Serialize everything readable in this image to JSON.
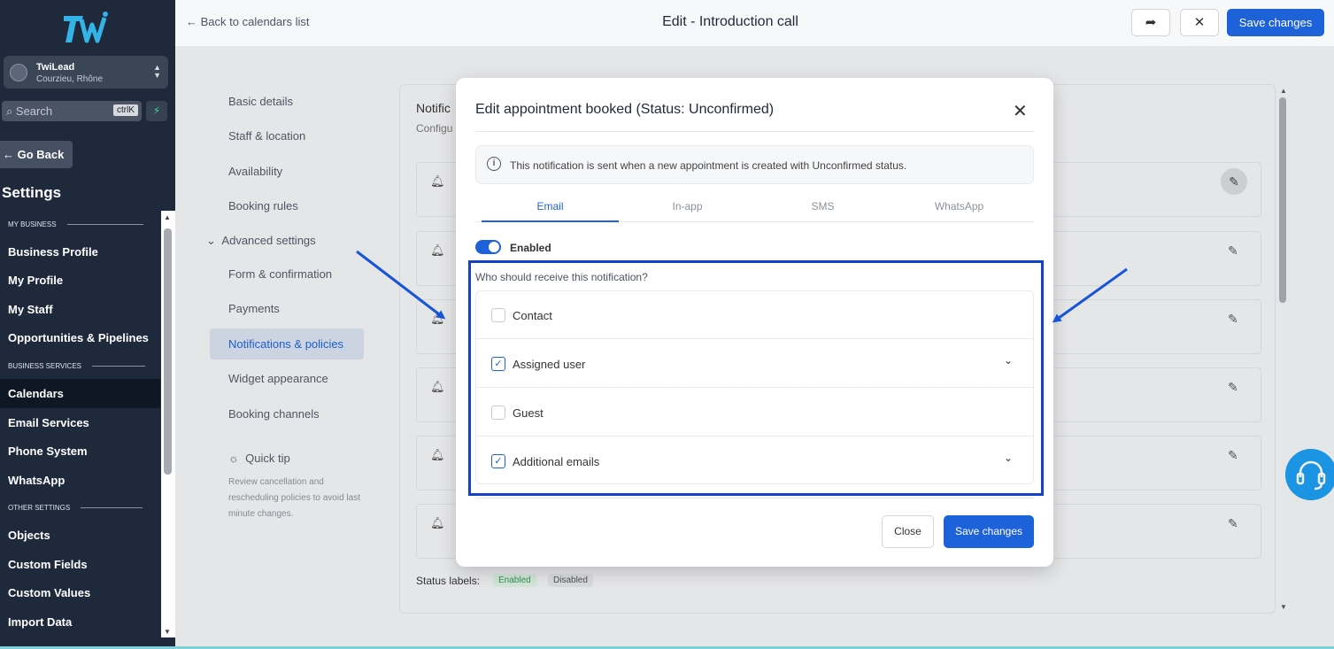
{
  "sidebar": {
    "account_name": "TwiLead",
    "account_location": "Courzieu, Rhône",
    "search_placeholder": "Search",
    "search_shortcut": "ctrlK",
    "go_back": "← Go Back",
    "settings_title": "Settings",
    "sections": {
      "my_business": "MY BUSINESS",
      "business_services": "BUSINESS SERVICES",
      "other_settings": "OTHER SETTINGS"
    },
    "items": {
      "business_profile": "Business Profile",
      "my_profile": "My Profile",
      "my_staff": "My Staff",
      "opportunities": "Opportunities & Pipelines",
      "calendars": "Calendars",
      "email_services": "Email Services",
      "phone_system": "Phone System",
      "whatsapp": "WhatsApp",
      "objects": "Objects",
      "custom_fields": "Custom Fields",
      "custom_values": "Custom Values",
      "import_data": "Import Data"
    }
  },
  "topbar": {
    "back_label": "Back to calendars list",
    "title": "Edit - Introduction call",
    "save_label": "Save changes"
  },
  "settings_nav": {
    "basic_details": "Basic details",
    "staff_location": "Staff & location",
    "availability": "Availability",
    "booking_rules": "Booking rules",
    "advanced_settings": "Advanced settings",
    "form_confirmation": "Form & confirmation",
    "payments": "Payments",
    "notifications_policies": "Notifications & policies",
    "widget_appearance": "Widget appearance",
    "booking_channels": "Booking channels",
    "quick_tip_title": "Quick tip",
    "quick_tip_body": "Review cancellation and rescheduling policies to avoid last minute changes."
  },
  "content": {
    "notif_title": "Notific",
    "notif_sub": "Configu",
    "status_labels": "Status labels:",
    "status_enabled": "Enabled",
    "status_disabled": "Disabled"
  },
  "modal": {
    "title": "Edit appointment booked (Status: Unconfirmed)",
    "info": "This notification is sent when a new appointment is created with Unconfirmed status.",
    "tabs": [
      "Email",
      "In-app",
      "SMS",
      "WhatsApp"
    ],
    "enabled_label": "Enabled",
    "who_label": "Who should receive this notification?",
    "options": [
      {
        "label": "Contact",
        "checked": false
      },
      {
        "label": "Assigned user",
        "checked": true
      },
      {
        "label": "Guest",
        "checked": false
      },
      {
        "label": "Additional emails",
        "checked": true
      }
    ],
    "close_label": "Close",
    "save_label": "Save changes"
  },
  "colors": {
    "accent": "#1d62d9",
    "sidebar_bg": "#1e2a3b",
    "highlight": "#1242c9"
  }
}
